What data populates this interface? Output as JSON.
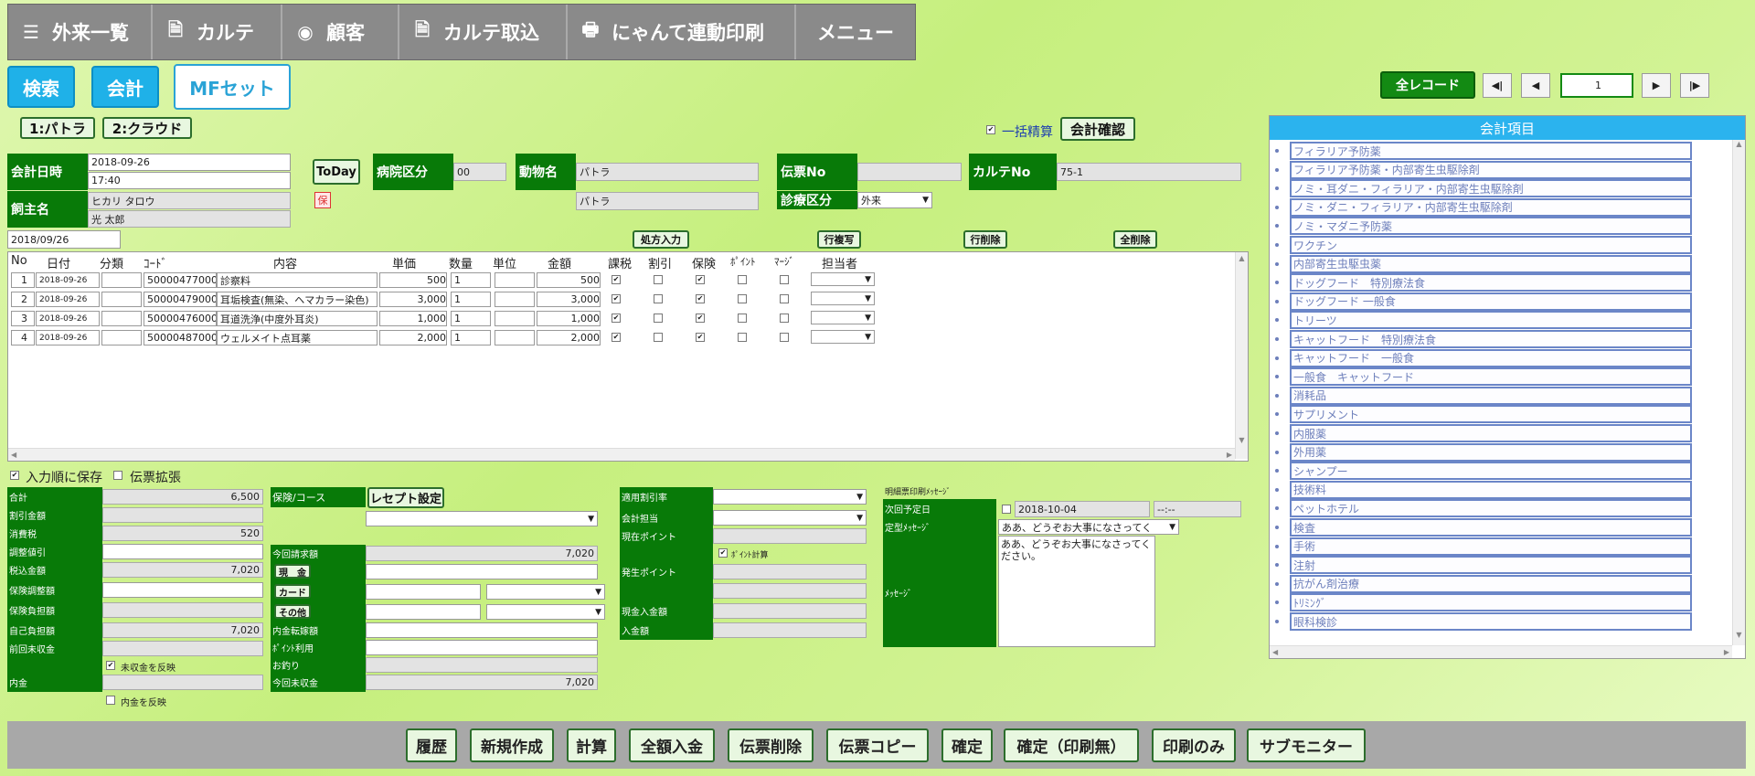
{
  "nav": [
    {
      "icon": "☰",
      "label": "外来一覧"
    },
    {
      "icon": "🗎",
      "label": "カルテ"
    },
    {
      "icon": "◉",
      "label": "顧客"
    },
    {
      "icon": "🗎",
      "label": "カルテ取込"
    },
    {
      "icon": "🖶",
      "label": "にゃんて連動印刷"
    },
    {
      "icon": "",
      "label": "メニュー"
    }
  ],
  "modes": {
    "search": "検索",
    "accounting": "会計",
    "mf_set": "MFセット"
  },
  "sub_tabs": {
    "a": "1:パトラ",
    "b": "2:クラウド"
  },
  "pager": {
    "all_records": "全レコード",
    "first": "◀|",
    "prev": "◀",
    "page": "1",
    "next": "▶",
    "last": "|▶"
  },
  "bulk": {
    "label": "一括精算",
    "confirm": "会計確認"
  },
  "header": {
    "date_label": "会計日時",
    "date": "2018-09-26",
    "time": "17:40",
    "today": "ToDay",
    "hospital_label": "病院区分",
    "hospital": "00",
    "animal_label": "動物名",
    "animal": "パトラ",
    "animal2": "パトラ",
    "slip_label": "伝票No",
    "slip": "",
    "chart_label": "カルテNo",
    "chart": "75-1",
    "owner_label": "飼主名",
    "owner_kana": "ヒカリ タロウ",
    "owner": "光 太郎",
    "ins_mark": "保",
    "treat_label": "診療区分",
    "treat": "外来",
    "filter_date": "2018/09/26"
  },
  "actions": {
    "rx": "処方入力",
    "copy_row": "行複写",
    "del_row": "行削除",
    "del_all": "全削除"
  },
  "table": {
    "headers": [
      "No",
      "日付",
      "分類",
      "ｺｰﾄﾞ",
      "内容",
      "単価",
      "数量",
      "単位",
      "金額",
      "課税",
      "割引",
      "保険",
      "ﾎﾟｲﾝﾄ",
      "ﾏｰｼﾞ",
      "担当者"
    ],
    "rows": [
      {
        "no": "1",
        "date": "2018-09-26",
        "cat": "",
        "code": "50000477000",
        "content": "診察料",
        "price": "500",
        "qty": "1",
        "unit": "",
        "amount": "500"
      },
      {
        "no": "2",
        "date": "2018-09-26",
        "cat": "",
        "code": "50000479000",
        "content": "耳垢検査(無染、ヘマカラー染色)",
        "price": "3,000",
        "qty": "1",
        "unit": "",
        "amount": "3,000"
      },
      {
        "no": "3",
        "date": "2018-09-26",
        "cat": "",
        "code": "50000476000",
        "content": "耳道洗浄(中度外耳炎)",
        "price": "1,000",
        "qty": "1",
        "unit": "",
        "amount": "1,000"
      },
      {
        "no": "4",
        "date": "2018-09-26",
        "cat": "",
        "code": "50000487000",
        "content": "ウェルメイト点耳薬",
        "price": "2,000",
        "qty": "1",
        "unit": "",
        "amount": "2,000"
      }
    ]
  },
  "opts": {
    "save_order": "入力順に保存",
    "expand": "伝票拡張"
  },
  "totals": {
    "total_l": "合計",
    "total": "6,500",
    "disc_l": "割引金額",
    "disc": "",
    "tax_l": "消費税",
    "tax": "520",
    "adj_l": "調整値引",
    "adj": "",
    "taxin_l": "税込金額",
    "taxin": "7,020",
    "insadj_l": "保険調整額",
    "insadj": "",
    "insburden_l": "保険負担額",
    "insburden": "",
    "self_l": "自己負担額",
    "self": "7,020",
    "prev_l": "前回未収金",
    "prev": "",
    "reflect1": "未収金を反映",
    "inner_l": "内金",
    "inner": "",
    "reflect2": "内金を反映"
  },
  "pay": {
    "course_l": "保険/コース",
    "receipt": "レセプト設定",
    "bill_l": "今回請求額",
    "bill": "7,020",
    "cash": "現　金",
    "card": "カード",
    "other": "その他",
    "transfer_l": "内金転嫁額",
    "point_use_l": "ﾎﾟｲﾝﾄ利用",
    "change_l": "お釣り",
    "unpaid_l": "今回未収金",
    "unpaid": "7,020"
  },
  "rate": {
    "rate_l": "適用割引率",
    "staff_l": "会計担当",
    "curpt_l": "現在ポイント",
    "ptcalc": "ﾎﾟｲﾝﾄ計算",
    "genpt_l": "発生ポイント",
    "cashin_l": "現金入金額",
    "in_l": "入金額"
  },
  "msg": {
    "title": "明細票印刷ﾒｯｾｰｼﾞ",
    "next_l": "次回予定日",
    "next_date": "2018-10-04",
    "next_time": "--:--",
    "fixed_l": "定型ﾒｯｾｰｼﾞ",
    "fixed": "ああ、どうぞお大事になさってく",
    "msg_l": "ﾒｯｾｰｼﾞ",
    "msg": "ああ、どうぞお大事になさってください。"
  },
  "right_panel": {
    "title": "会計項目",
    "items": [
      "フィラリア予防薬",
      "フィラリア予防薬・内部寄生虫駆除剤",
      "ノミ・耳ダニ・フィラリア・内部寄生虫駆除剤",
      "ノミ・ダニ・フィラリア・内部寄生虫駆除剤",
      "ノミ・マダニ予防薬",
      "ワクチン",
      "内部寄生虫駆虫薬",
      "ドッグフード　特別療法食",
      "ドッグフード 一般食",
      "トリーツ",
      "キャットフード　特別療法食",
      "キャットフード　一般食",
      "一般食　キャットフード",
      "消耗品",
      "サプリメント",
      "内服薬",
      "外用薬",
      "シャンプー",
      "技術料",
      "ペットホテル",
      "検査",
      "手術",
      "注射",
      "抗がん剤治療",
      "ﾄﾘﾐﾝｸﾞ",
      "眼科検診"
    ]
  },
  "bottom": [
    "履歴",
    "新規作成",
    "計算",
    "全額入金",
    "伝票削除",
    "伝票コピー",
    "確定",
    "確定（印刷無）",
    "印刷のみ",
    "サブモニター"
  ],
  "colors": {
    "green": "#087a08",
    "blue": "#1fb1e8",
    "bg": "#d2f395"
  }
}
